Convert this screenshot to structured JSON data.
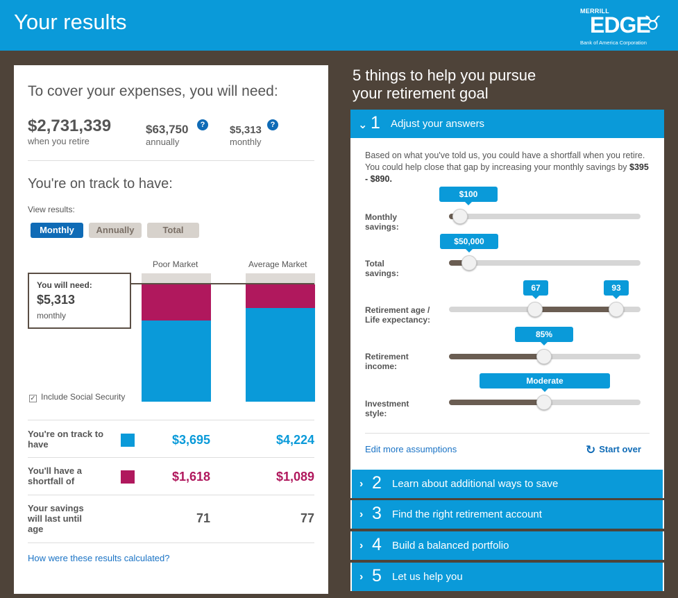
{
  "header": {
    "title": "Your results",
    "logo": {
      "line1": "MERRILL",
      "line2": "EDGE",
      "line3": "Bank of America Corporation"
    }
  },
  "left": {
    "cover_title": "To cover your expenses, you will need:",
    "totals": [
      {
        "value": "$2,731,339",
        "label": "when you retire"
      },
      {
        "value": "$63,750",
        "label": "annually"
      },
      {
        "value": "$5,313",
        "label": "monthly"
      }
    ],
    "help_icon": "?",
    "track_title": "You're on track to have:",
    "view_label": "View results:",
    "view_options": [
      "Monthly",
      "Annually",
      "Total"
    ],
    "selected_view": "Monthly",
    "chart": {
      "columns": [
        "Poor Market",
        "Average Market"
      ],
      "need_box": {
        "title": "You will need:",
        "value": "$5,313",
        "period": "monthly"
      },
      "include_social_security": "Include Social Security",
      "include_social_security_checked": true
    },
    "rows": [
      {
        "label": "You're on track to have",
        "poor": "$3,695",
        "average": "$4,224"
      },
      {
        "label": "You'll have a shortfall of",
        "poor": "$1,618",
        "average": "$1,089"
      },
      {
        "label": "Your savings will last until age",
        "poor": "71",
        "average": "77"
      }
    ],
    "calc_link": "How were these results calculated?"
  },
  "right": {
    "title_line1": "5 things to help you pursue",
    "title_line2": "your retirement goal",
    "sections": [
      {
        "num": "1",
        "label": "Adjust your answers",
        "chevron": "⌄"
      },
      {
        "num": "2",
        "label": "Learn about additional ways to save",
        "chevron": "›"
      },
      {
        "num": "3",
        "label": "Find the right retirement account",
        "chevron": "›"
      },
      {
        "num": "4",
        "label": "Build a balanced portfolio",
        "chevron": "›"
      },
      {
        "num": "5",
        "label": "Let us help you",
        "chevron": "›"
      }
    ],
    "intro_text": "Based on what you've told us, you could have a shortfall when you retire. You could help close that gap by increasing your monthly savings by ",
    "intro_range": "$395 - $890.",
    "sliders": {
      "monthly_savings": {
        "label": "Monthly savings:",
        "value": "$100"
      },
      "total_savings": {
        "label": "Total savings:",
        "value": "$50,000"
      },
      "retirement_age": {
        "label": "Retirement age / Life expectancy:",
        "value_low": "67",
        "value_high": "93"
      },
      "retirement_income": {
        "label": "Retirement income:",
        "value": "85%"
      },
      "investment_style": {
        "label": "Investment style:",
        "value": "Moderate"
      }
    },
    "edit_link": "Edit more assumptions",
    "start_over": "Start over"
  },
  "colors": {
    "accent": "#0a9ad9",
    "shortfall": "#b0185d",
    "button": "#0f6bb6",
    "background": "#4e4339"
  }
}
